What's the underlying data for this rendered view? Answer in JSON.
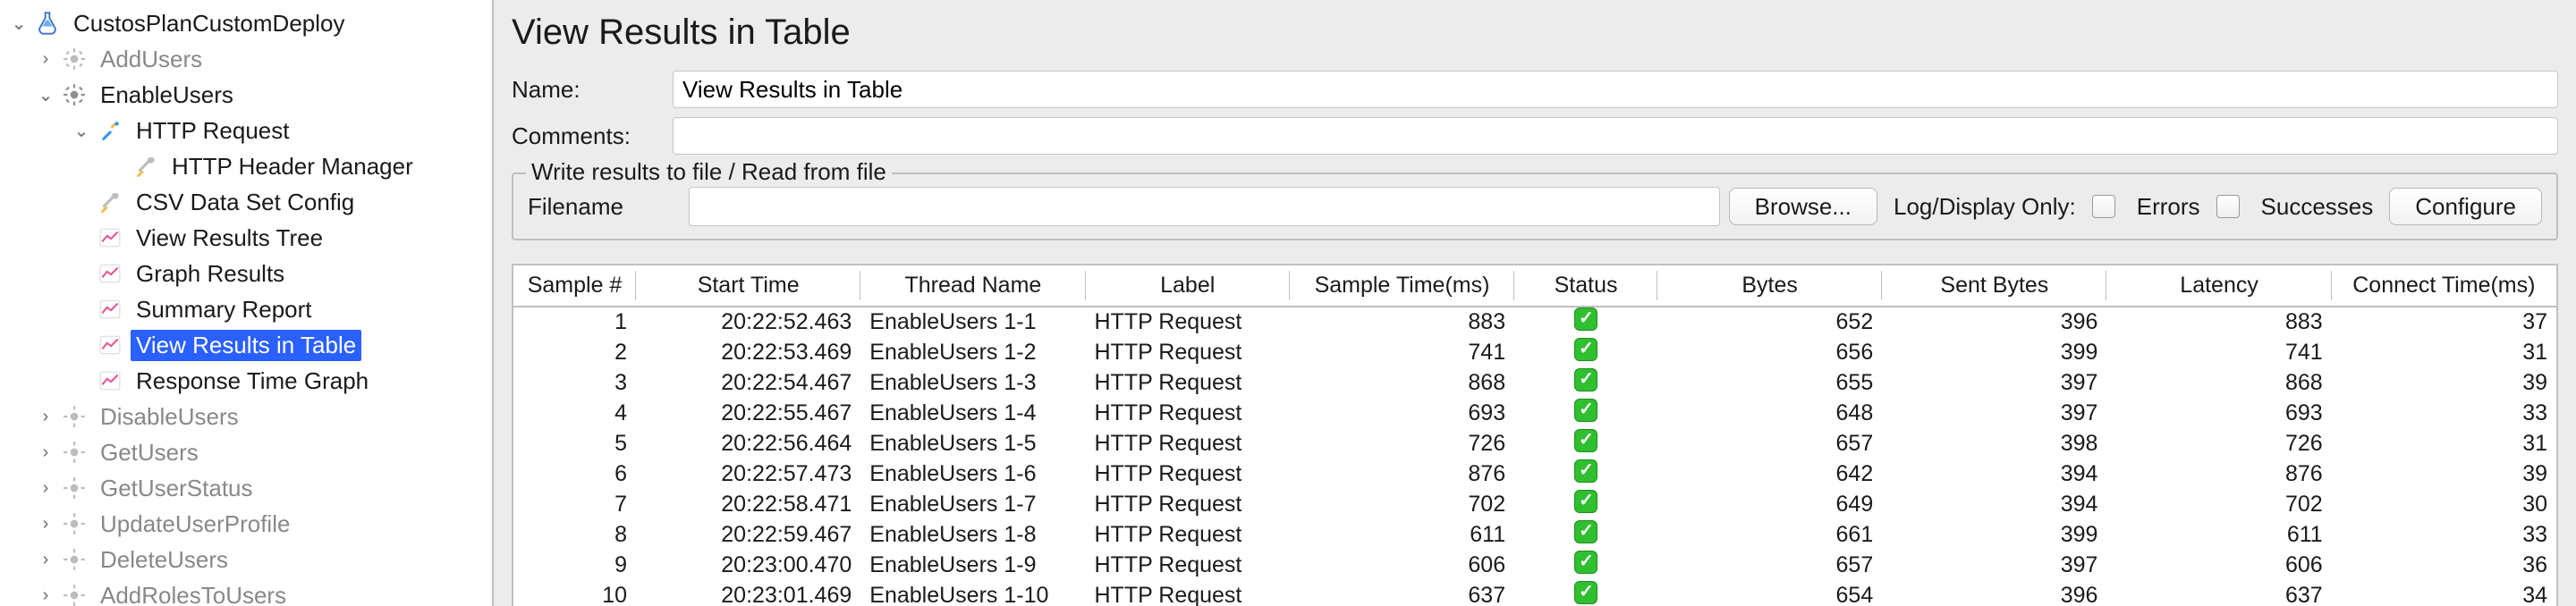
{
  "tree": {
    "root": {
      "label": "CustosPlanCustomDeploy"
    },
    "addUsers": {
      "label": "AddUsers"
    },
    "enableUsers": {
      "label": "EnableUsers"
    },
    "httpRequest": {
      "label": "HTTP Request"
    },
    "httpHeader": {
      "label": "HTTP Header Manager"
    },
    "csvData": {
      "label": "CSV Data Set Config"
    },
    "viewTree": {
      "label": "View Results Tree"
    },
    "graphResults": {
      "label": "Graph Results"
    },
    "summaryReport": {
      "label": "Summary Report"
    },
    "viewTable": {
      "label": "View Results in Table"
    },
    "responseGraph": {
      "label": "Response Time Graph"
    },
    "disableUsers": {
      "label": "DisableUsers"
    },
    "getUsers": {
      "label": "GetUsers"
    },
    "getUserStatus": {
      "label": "GetUserStatus"
    },
    "updateUserProfile": {
      "label": "UpdateUserProfile"
    },
    "deleteUsers": {
      "label": "DeleteUsers"
    },
    "addRolesToUsers": {
      "label": "AddRolesToUsers"
    }
  },
  "detail": {
    "title": "View Results in Table",
    "nameLabel": "Name:",
    "nameValue": "View Results in Table",
    "commentsLabel": "Comments:",
    "commentsValue": ""
  },
  "file": {
    "legend": "Write results to file / Read from file",
    "filenameLabel": "Filename",
    "filenameValue": "",
    "browse": "Browse...",
    "logDisplay": "Log/Display Only:",
    "errors": "Errors",
    "successes": "Successes",
    "configure": "Configure"
  },
  "table": {
    "headers": [
      "Sample #",
      "Start Time",
      "Thread Name",
      "Label",
      "Sample Time(ms)",
      "Status",
      "Bytes",
      "Sent Bytes",
      "Latency",
      "Connect Time(ms)"
    ],
    "rows": [
      {
        "n": 1,
        "start": "20:22:52.463",
        "thread": "EnableUsers 1-1",
        "label": "HTTP Request",
        "stime": 883,
        "ok": true,
        "bytes": 652,
        "sent": 396,
        "lat": 883,
        "conn": 37
      },
      {
        "n": 2,
        "start": "20:22:53.469",
        "thread": "EnableUsers 1-2",
        "label": "HTTP Request",
        "stime": 741,
        "ok": true,
        "bytes": 656,
        "sent": 399,
        "lat": 741,
        "conn": 31
      },
      {
        "n": 3,
        "start": "20:22:54.467",
        "thread": "EnableUsers 1-3",
        "label": "HTTP Request",
        "stime": 868,
        "ok": true,
        "bytes": 655,
        "sent": 397,
        "lat": 868,
        "conn": 39
      },
      {
        "n": 4,
        "start": "20:22:55.467",
        "thread": "EnableUsers 1-4",
        "label": "HTTP Request",
        "stime": 693,
        "ok": true,
        "bytes": 648,
        "sent": 397,
        "lat": 693,
        "conn": 33
      },
      {
        "n": 5,
        "start": "20:22:56.464",
        "thread": "EnableUsers 1-5",
        "label": "HTTP Request",
        "stime": 726,
        "ok": true,
        "bytes": 657,
        "sent": 398,
        "lat": 726,
        "conn": 31
      },
      {
        "n": 6,
        "start": "20:22:57.473",
        "thread": "EnableUsers 1-6",
        "label": "HTTP Request",
        "stime": 876,
        "ok": true,
        "bytes": 642,
        "sent": 394,
        "lat": 876,
        "conn": 39
      },
      {
        "n": 7,
        "start": "20:22:58.471",
        "thread": "EnableUsers 1-7",
        "label": "HTTP Request",
        "stime": 702,
        "ok": true,
        "bytes": 649,
        "sent": 394,
        "lat": 702,
        "conn": 30
      },
      {
        "n": 8,
        "start": "20:22:59.467",
        "thread": "EnableUsers 1-8",
        "label": "HTTP Request",
        "stime": 611,
        "ok": true,
        "bytes": 661,
        "sent": 399,
        "lat": 611,
        "conn": 33
      },
      {
        "n": 9,
        "start": "20:23:00.470",
        "thread": "EnableUsers 1-9",
        "label": "HTTP Request",
        "stime": 606,
        "ok": true,
        "bytes": 657,
        "sent": 397,
        "lat": 606,
        "conn": 36
      },
      {
        "n": 10,
        "start": "20:23:01.469",
        "thread": "EnableUsers 1-10",
        "label": "HTTP Request",
        "stime": 637,
        "ok": true,
        "bytes": 654,
        "sent": 396,
        "lat": 637,
        "conn": 34
      }
    ]
  }
}
